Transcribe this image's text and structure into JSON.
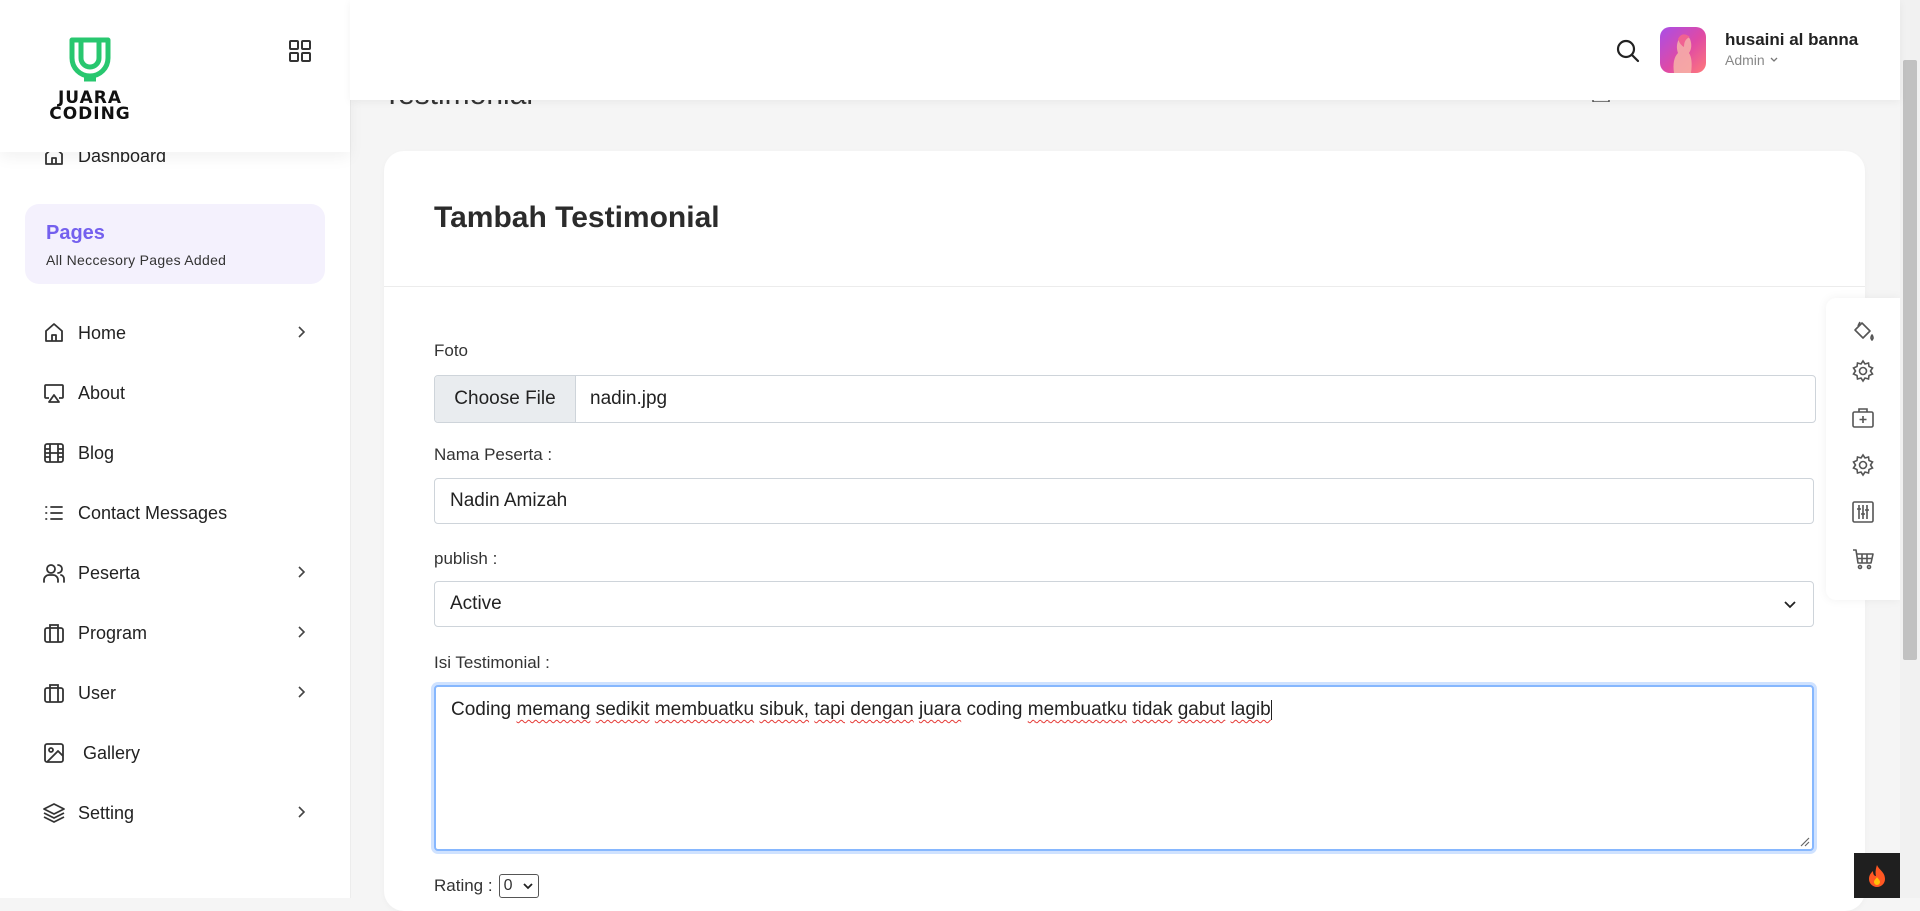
{
  "brand": {
    "line1": "JUARA",
    "line2": "CODING",
    "color": "#28c76f"
  },
  "sidebar": {
    "dashboard": "Dashboard",
    "section": {
      "title": "Pages",
      "subtitle": "All Neccesory Pages Added"
    },
    "items": [
      {
        "label": "Home",
        "icon": "home-icon",
        "has_submenu": true
      },
      {
        "label": "About",
        "icon": "monitor-icon",
        "has_submenu": false
      },
      {
        "label": "Blog",
        "icon": "film-icon",
        "has_submenu": false
      },
      {
        "label": "Contact Messages",
        "icon": "list-icon",
        "has_submenu": false
      },
      {
        "label": "Peserta",
        "icon": "users-icon",
        "has_submenu": true
      },
      {
        "label": "Program",
        "icon": "briefcase-icon",
        "has_submenu": true
      },
      {
        "label": "User",
        "icon": "briefcase-icon",
        "has_submenu": true
      },
      {
        "label": "Gallery",
        "icon": "image-icon",
        "has_submenu": false
      },
      {
        "label": "Setting",
        "icon": "layers-icon",
        "has_submenu": true
      }
    ]
  },
  "header": {
    "user_name": "husaini al banna",
    "user_role": "Admin"
  },
  "page": {
    "title_behind": "Testimonial"
  },
  "form": {
    "title": "Tambah Testimonial",
    "foto_label": "Foto",
    "file_button": "Choose File",
    "file_name": "nadin.jpg",
    "nama_label": "Nama Peserta :",
    "nama_value": "Nadin Amizah",
    "publish_label": "publish :",
    "publish_value": "Active",
    "isi_label": "Isi Testimonial :",
    "isi_words": [
      "Coding",
      "memang",
      "sedikit",
      "membuatku",
      "sibuk,",
      "tapi",
      "dengan",
      "juara",
      "coding",
      "membuatku",
      "tidak",
      "gabut",
      "lagib"
    ],
    "rating_label": "Rating :",
    "rating_value": "0"
  },
  "colors": {
    "accent": "#7460ee",
    "focus": "#86b7fe"
  }
}
